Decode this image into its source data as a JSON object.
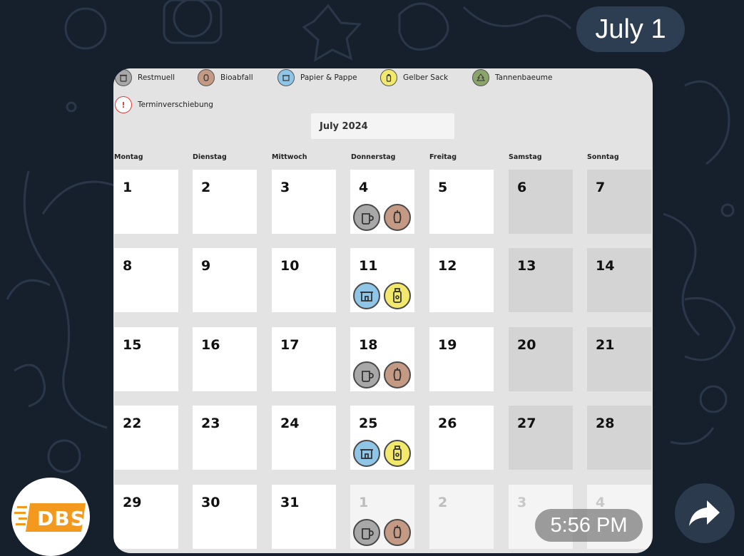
{
  "chat": {
    "date_label": "July 1",
    "message_time": "5:56 PM"
  },
  "sender": {
    "avatar_text": "DBS",
    "avatar_color": "#f39a1e"
  },
  "calendar": {
    "legend": [
      {
        "label": "Restmuell",
        "color": "#a8a8a8",
        "icon": "restmuell-bin-icon"
      },
      {
        "label": "Bioabfall",
        "color": "#c49a85",
        "icon": "bioabfall-apple-core-icon"
      },
      {
        "label": "Papier & Pappe",
        "color": "#8fc6e8",
        "icon": "papier-box-icon"
      },
      {
        "label": "Gelber Sack",
        "color": "#f2e86c",
        "icon": "gelber-sack-bottle-icon"
      },
      {
        "label": "Tannenbaeume",
        "color": "#8aa46a",
        "icon": "tannenbaum-tree-icon"
      },
      {
        "label": "Terminverschiebung",
        "color": "#e53935",
        "icon": "exclamation-icon"
      }
    ],
    "month_label": "July 2024",
    "weekdays": [
      "Montag",
      "Dienstag",
      "Mittwoch",
      "Donnerstag",
      "Freitag",
      "Samstag",
      "Sonntag"
    ],
    "weeks": [
      [
        {
          "day": "1",
          "type": "current",
          "pickups": []
        },
        {
          "day": "2",
          "type": "current",
          "pickups": []
        },
        {
          "day": "3",
          "type": "current",
          "pickups": []
        },
        {
          "day": "4",
          "type": "current",
          "pickups": [
            "restmuell",
            "bioabfall"
          ]
        },
        {
          "day": "5",
          "type": "current",
          "pickups": []
        },
        {
          "day": "6",
          "type": "weekend",
          "pickups": []
        },
        {
          "day": "7",
          "type": "weekend",
          "pickups": []
        }
      ],
      [
        {
          "day": "8",
          "type": "current",
          "pickups": []
        },
        {
          "day": "9",
          "type": "current",
          "pickups": []
        },
        {
          "day": "10",
          "type": "current",
          "pickups": []
        },
        {
          "day": "11",
          "type": "current",
          "pickups": [
            "papier",
            "gelber"
          ]
        },
        {
          "day": "12",
          "type": "current",
          "pickups": []
        },
        {
          "day": "13",
          "type": "weekend",
          "pickups": []
        },
        {
          "day": "14",
          "type": "weekend",
          "pickups": []
        }
      ],
      [
        {
          "day": "15",
          "type": "current",
          "pickups": []
        },
        {
          "day": "16",
          "type": "current",
          "pickups": []
        },
        {
          "day": "17",
          "type": "current",
          "pickups": []
        },
        {
          "day": "18",
          "type": "current",
          "pickups": [
            "restmuell",
            "bioabfall"
          ]
        },
        {
          "day": "19",
          "type": "current",
          "pickups": []
        },
        {
          "day": "20",
          "type": "weekend",
          "pickups": []
        },
        {
          "day": "21",
          "type": "weekend",
          "pickups": []
        }
      ],
      [
        {
          "day": "22",
          "type": "current",
          "pickups": []
        },
        {
          "day": "23",
          "type": "current",
          "pickups": []
        },
        {
          "day": "24",
          "type": "current",
          "pickups": []
        },
        {
          "day": "25",
          "type": "current",
          "pickups": [
            "papier",
            "gelber"
          ]
        },
        {
          "day": "26",
          "type": "current",
          "pickups": []
        },
        {
          "day": "27",
          "type": "weekend",
          "pickups": []
        },
        {
          "day": "28",
          "type": "weekend",
          "pickups": []
        }
      ],
      [
        {
          "day": "29",
          "type": "current",
          "pickups": []
        },
        {
          "day": "30",
          "type": "current",
          "pickups": []
        },
        {
          "day": "31",
          "type": "current",
          "pickups": []
        },
        {
          "day": "1",
          "type": "other",
          "pickups": [
            "restmuell",
            "bioabfall"
          ]
        },
        {
          "day": "2",
          "type": "other",
          "pickups": []
        },
        {
          "day": "3",
          "type": "other-weekend",
          "pickups": []
        },
        {
          "day": "4",
          "type": "other-weekend",
          "pickups": []
        }
      ]
    ]
  }
}
